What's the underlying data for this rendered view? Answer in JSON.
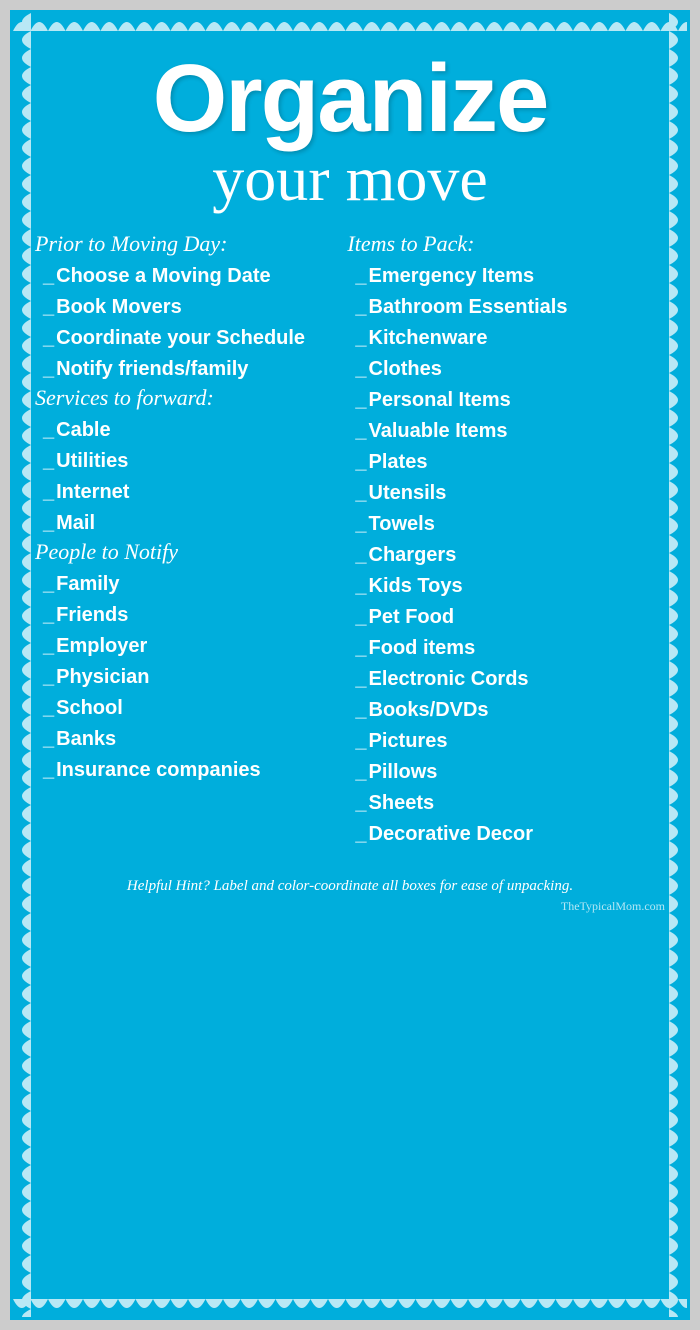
{
  "title": {
    "line1": "Organize",
    "line2": "your move"
  },
  "left_column": {
    "sections": [
      {
        "header": "Prior to Moving Day:",
        "items": [
          "Choose a Moving Date",
          "Book Movers",
          "Coordinate your Schedule",
          "Notify friends/family"
        ]
      },
      {
        "header": "Services to forward:",
        "items": [
          "Cable",
          "Utilities",
          "Internet",
          "Mail"
        ]
      },
      {
        "header": "People to Notify",
        "items": [
          "Family",
          "Friends",
          "Employer",
          "Physician",
          "School",
          "Banks",
          "Insurance companies"
        ]
      }
    ]
  },
  "right_column": {
    "header": "Items to Pack:",
    "items": [
      "Emergency Items",
      "Bathroom  Essentials",
      "Kitchenware",
      "Clothes",
      "Personal  Items",
      "Valuable  Items",
      "Plates",
      "Utensils",
      "Towels",
      "Chargers",
      "Kids  Toys",
      "Pet Food",
      "Food items",
      "Electronic Cords",
      "Books/DVDs",
      "Pictures",
      "Pillows",
      "Sheets",
      "Decorative  Decor"
    ]
  },
  "footer": {
    "hint": "Helpful Hint?  Label and color-coordinate all boxes for ease of unpacking.",
    "watermark": "TheTypicalMom.com"
  },
  "colors": {
    "background": "#00AEDC",
    "text": "#ffffff"
  }
}
